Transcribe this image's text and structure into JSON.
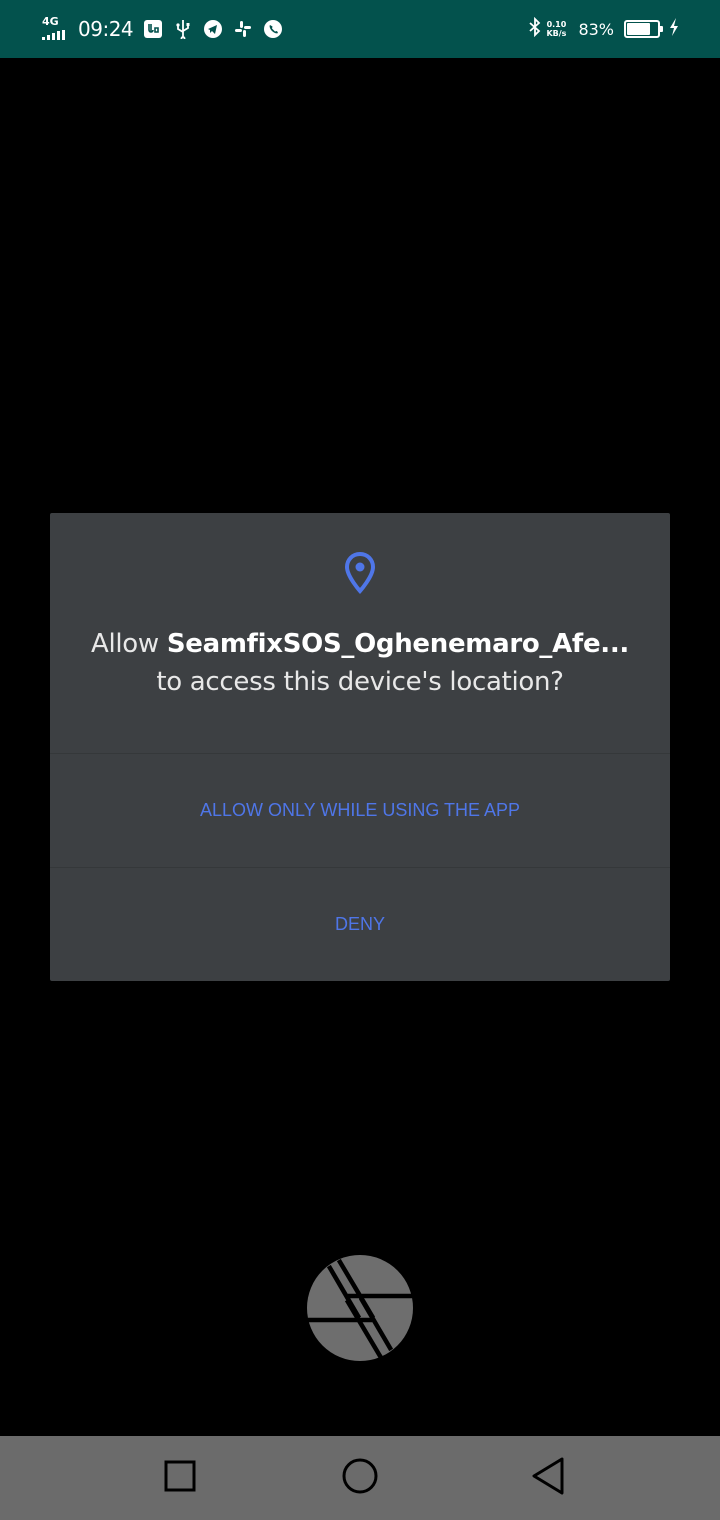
{
  "status_bar": {
    "network_type": "4G",
    "time": "09:24",
    "icons": [
      "usb-debug-icon",
      "usb-icon",
      "telegram-icon",
      "slack-icon",
      "whatsapp-icon"
    ],
    "bluetooth_icon": "bluetooth-icon",
    "speed_value": "0.10",
    "speed_unit": "KB/s",
    "battery_percent_text": "83%",
    "battery_level": 0.83,
    "charging_icon": "charging-icon"
  },
  "dialog": {
    "icon": "location-pin-icon",
    "message_prefix": "Allow ",
    "app_name": "SeamfixSOS_Oghenemaro_Afe...",
    "message_suffix": " to access this device's location?",
    "allow_label": "ALLOW ONLY WHILE USING THE APP",
    "deny_label": "DENY"
  },
  "camera": {
    "shutter_icon": "camera-shutter-icon"
  },
  "nav_bar": {
    "recents": "recents-square-icon",
    "home": "home-circle-icon",
    "back": "back-triangle-icon"
  },
  "colors": {
    "status_bar_bg": "#03524d",
    "dialog_bg": "#3d4043",
    "accent": "#4f76e8",
    "nav_bar_bg": "#6b6b6b"
  }
}
